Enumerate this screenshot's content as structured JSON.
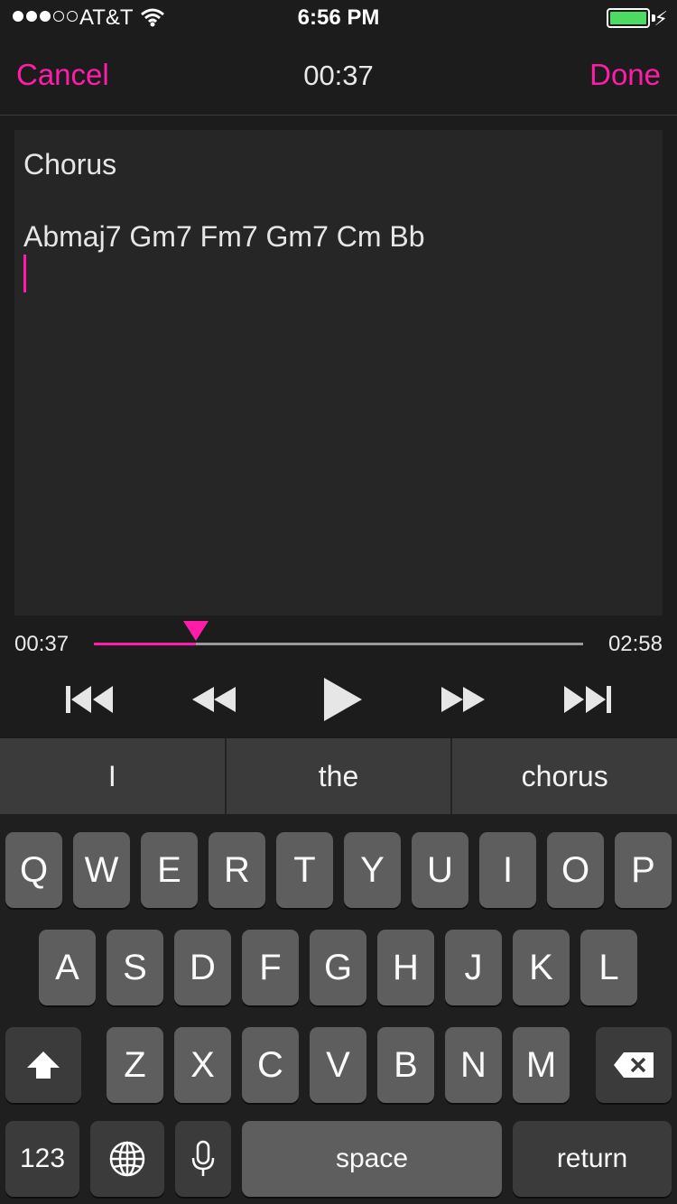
{
  "status": {
    "carrier": "AT&T",
    "time": "6:56 PM",
    "signal_bars_filled": 3,
    "signal_bars_total": 5,
    "battery_level": 1.0,
    "battery_color": "#4cd964"
  },
  "nav": {
    "cancel_label": "Cancel",
    "title": "00:37",
    "done_label": "Done"
  },
  "editor": {
    "lines": [
      "Chorus",
      "",
      "Abmaj7 Gm7 Fm7 Gm7 Cm Bb"
    ]
  },
  "player": {
    "elapsed": "00:37",
    "duration": "02:58",
    "progress": 0.2079,
    "accent": "#ff1ca8"
  },
  "transport": {
    "icons": [
      "skip-back-icon",
      "rewind-icon",
      "play-icon",
      "fast-forward-icon",
      "skip-forward-icon"
    ]
  },
  "suggestions": [
    "I",
    "the",
    "chorus"
  ],
  "keyboard": {
    "row1": [
      "Q",
      "W",
      "E",
      "R",
      "T",
      "Y",
      "U",
      "I",
      "O",
      "P"
    ],
    "row2": [
      "A",
      "S",
      "D",
      "F",
      "G",
      "H",
      "J",
      "K",
      "L"
    ],
    "row3": [
      "Z",
      "X",
      "C",
      "V",
      "B",
      "N",
      "M"
    ],
    "numbers_label": "123",
    "space_label": "space",
    "return_label": "return",
    "shift_icon": "shift-icon",
    "delete_icon": "delete-icon",
    "globe_icon": "globe-icon",
    "mic_icon": "microphone-icon"
  }
}
